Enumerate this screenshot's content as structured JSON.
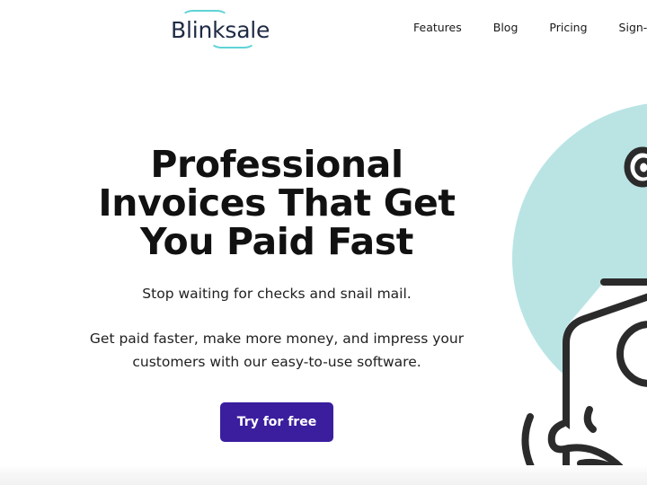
{
  "page": {
    "background": "#ffffff",
    "accent_purple": "#3b1e9e",
    "accent_teal": "#bae4e4",
    "logo_navy": "#1f2b45",
    "logo_arc_teal": "#5fd3d6"
  },
  "header": {
    "logo": {
      "text": "Blinksale",
      "icon_top": "arc-top-icon",
      "icon_bottom": "arc-bottom-icon"
    },
    "nav": [
      {
        "label": "Features"
      },
      {
        "label": "Blog"
      },
      {
        "label": "Pricing"
      },
      {
        "label": "Sign-in (Classic"
      }
    ]
  },
  "hero": {
    "headline_lines": [
      "Professional",
      "Invoices That Get",
      "You Paid Fast"
    ],
    "subheading": "Stop waiting for checks and snail mail.",
    "description_lines": [
      "Get paid faster, make more money, and impress your",
      "customers with our easy-to-use software."
    ],
    "cta_label": "Try for free"
  },
  "illustration": {
    "name": "hand-holding-invoice-illustration",
    "circle_color": "#bae4e4",
    "line_color": "#2b2b2b"
  }
}
